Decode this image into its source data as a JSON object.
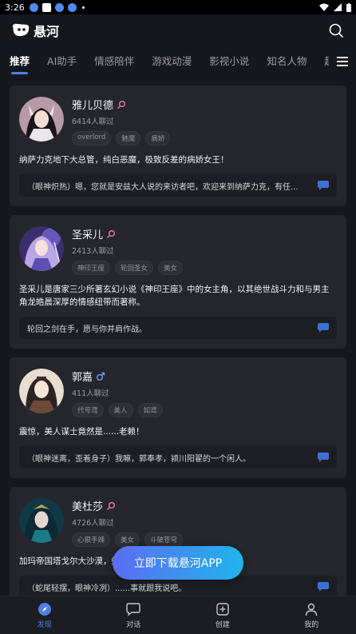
{
  "status_bar": {
    "time": "3:26"
  },
  "app": {
    "name": "悬河"
  },
  "tabs": [
    {
      "label": "推荐",
      "active": true
    },
    {
      "label": "AI助手"
    },
    {
      "label": "情感陪伴"
    },
    {
      "label": "游戏动漫"
    },
    {
      "label": "影视小说"
    },
    {
      "label": "知名人物"
    },
    {
      "label": "趣"
    }
  ],
  "cards": [
    {
      "name": "雅儿贝德",
      "gender": "female",
      "count": "6414人聊过",
      "tags": [
        "overlord",
        "魅魔",
        "病娇"
      ],
      "desc": "纳萨力克地下大总管，纯白恶魔，极致反差的病娇女王！",
      "quote": "（眼神炽热）嗯，您就是安兹大人说的来访者吧，欢迎来到纳萨力克，有任..."
    },
    {
      "name": "圣采儿",
      "gender": "female",
      "count": "2413人聊过",
      "tags": [
        "神印王座",
        "轮回圣女",
        "美女"
      ],
      "desc": "圣采儿是唐家三少所著玄幻小说《神印王座》中的女主角，以其绝世战斗力和与男主角龙皓晨深厚的情感纽带而著称。",
      "quote": "轮回之剑在手，愿与你并肩作战。"
    },
    {
      "name": "郭嘉",
      "gender": "male",
      "count": "411人聊过",
      "tags": [
        "代号鸢",
        "美人",
        "如鸢"
      ],
      "desc": "震惊，美人谋士竟然是......老赖！",
      "quote": "（眼神迷离，歪着身子）我嘛，郭奉孝，颍川阳翟的一个闲人。"
    },
    {
      "name": "美杜莎",
      "gender": "female",
      "count": "4726人聊过",
      "tags": [
        "心狠手辣",
        "美女",
        "斗破苍穹"
      ],
      "desc": "加玛帝国塔戈尔大沙漠，蛇人族女王。",
      "quote": "（蛇尾轻摆，眼神冷冽）......事就跟我说吧。"
    }
  ],
  "download": {
    "label": "立即下载悬河APP"
  },
  "bottom_nav": [
    {
      "label": "发现",
      "icon": "compass-icon",
      "active": true
    },
    {
      "label": "对话",
      "icon": "chat-bubble-icon"
    },
    {
      "label": "创建",
      "icon": "plus-square-icon"
    },
    {
      "label": "我的",
      "icon": "person-icon"
    }
  ],
  "colors": {
    "background": "#16171c",
    "card": "#24262c",
    "accent": "#4f7fe8",
    "female": "#e67ab0",
    "male": "#6fa0f0",
    "chat_icon": "#3d6fd9"
  }
}
